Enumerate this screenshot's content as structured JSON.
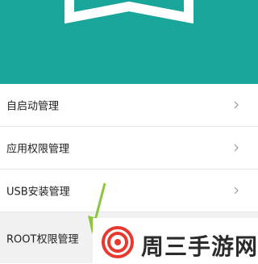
{
  "menu": {
    "items": [
      {
        "label": "自启动管理"
      },
      {
        "label": "应用权限管理"
      },
      {
        "label": "USB安装管理"
      },
      {
        "label": "ROOT权限管理"
      }
    ]
  },
  "watermark": {
    "text": "周三手游网"
  },
  "colors": {
    "header_bg": "#1aa59a",
    "arrow": "#8cc63f",
    "logo_red": "#e8392f"
  }
}
